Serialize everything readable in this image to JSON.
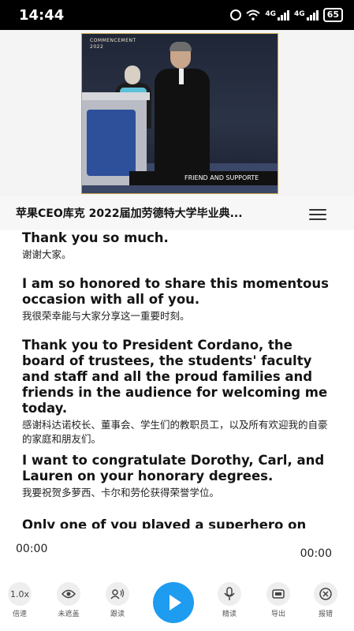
{
  "status_bar": {
    "time": "14:44",
    "net1": "4G",
    "net2": "4G",
    "battery": "65"
  },
  "video": {
    "overlay_top": "COMMENCEMENT",
    "overlay_year": "2022",
    "overlay_bottom": "FRIEND AND SUPPORTE"
  },
  "header": {
    "title": "苹果CEO库克 2022届加劳德特大学毕业典..."
  },
  "transcript": [
    {
      "en": "Thank you so much.",
      "zh": "谢谢大家。"
    },
    {
      "en": "I am so honored to share this momentous occasion with all of you.",
      "zh": "我很荣幸能与大家分享这一重要时刻。"
    },
    {
      "en": "Thank you to President Cordano, the board of trustees, the students' faculty and staff and all the proud families and friends in the audience for welcoming me today.",
      "zh": "感谢科达诺校长、董事会、学生们的教职员工，以及所有欢迎我的自豪的家庭和朋友们。"
    },
    {
      "en": "I want to congratulate Dorothy, Carl, and Lauren on your honorary degrees.",
      "zh": "我要祝贺多萝西、卡尔和劳伦获得荣誉学位。"
    },
    {
      "en": "Only one of you played a superhero on",
      "zh": ""
    }
  ],
  "player": {
    "current_time": "00:00",
    "total_time": "00:00"
  },
  "toolbar": {
    "speed": {
      "icon": "1.0x",
      "label": "倍速"
    },
    "cover": {
      "icon": "eye-icon",
      "label": "未遮盖"
    },
    "follow": {
      "icon": "speaker-icon",
      "label": "跟读"
    },
    "play": {
      "icon": "play-icon"
    },
    "intensive": {
      "icon": "microphone-icon",
      "label": "精读"
    },
    "export": {
      "icon": "pdf-icon",
      "label": "导出"
    },
    "report": {
      "icon": "close-circle-icon",
      "label": "报错"
    }
  }
}
